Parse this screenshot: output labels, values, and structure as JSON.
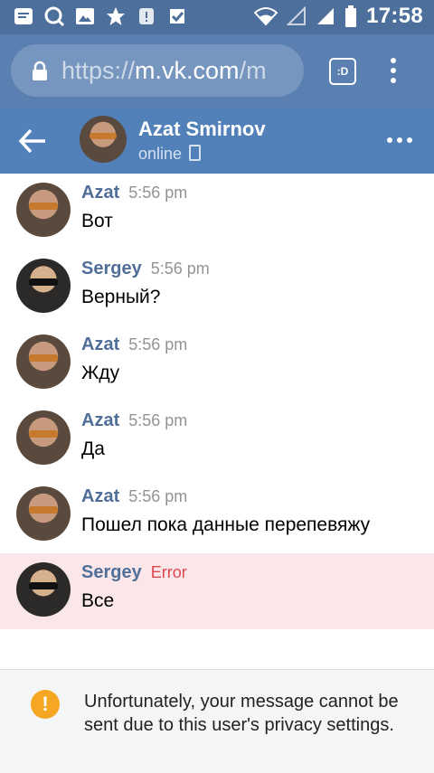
{
  "status_bar": {
    "time": "17:58",
    "icons_left": [
      "message-icon",
      "search-icon",
      "image-icon",
      "star-icon",
      "notification-icon",
      "check-icon"
    ],
    "icons_right": [
      "wifi-icon",
      "signal-icon",
      "signal-icon",
      "battery-icon"
    ]
  },
  "browser": {
    "url_scheme": "https://",
    "url_host": "m.vk.com",
    "url_path": "/m",
    "tab_label": ":D"
  },
  "chat": {
    "name": "Azat Smirnov",
    "status": "online"
  },
  "messages": [
    {
      "author": "Azat",
      "time": "5:56 pm",
      "text": "Вот"
    },
    {
      "author": "Sergey",
      "time": "5:56 pm",
      "text": "Верный?"
    },
    {
      "author": "Azat",
      "time": "5:56 pm",
      "text": "Жду"
    },
    {
      "author": "Azat",
      "time": "5:56 pm",
      "text": "Да"
    },
    {
      "author": "Azat",
      "time": "5:56 pm",
      "text": "Пошел пока данные перепевяжу"
    },
    {
      "author": "Sergey",
      "time": "Error",
      "text": "Все"
    }
  ],
  "notice": {
    "icon": "!",
    "text": "Unfortunately, your message cannot be sent due to this user's privacy settings."
  },
  "colors": {
    "header": "#5181b8",
    "author": "#4f6f98",
    "error": "#e0464f",
    "error_bg": "#fbe7e9",
    "warning": "#f5a623"
  }
}
